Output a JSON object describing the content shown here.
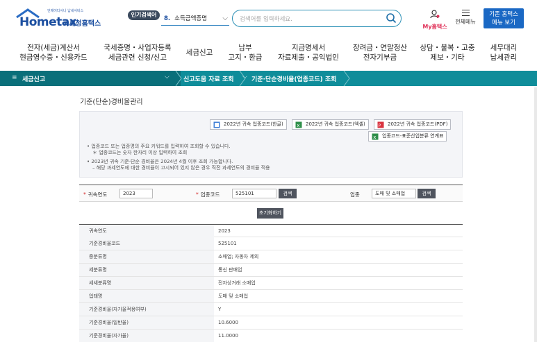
{
  "header": {
    "logo_slogan": "언제어디서나 납세서비스",
    "logo_brand": "Hometax",
    "logo_brand_kr": "국세청홈택스",
    "popular_badge": "인기검색어",
    "popular_rank": "8.",
    "popular_term": "소득금액증명",
    "search_placeholder": "검색어를 입력하세요.",
    "my_hometax": "My홈택스",
    "all_menu": "전체메뉴",
    "basic_btn_line1": "기존 홈택스",
    "basic_btn_line2": "메뉴 보기"
  },
  "gnb": [
    {
      "line1": "전자(세금)계산서",
      "line2": "현금영수증・신용카드"
    },
    {
      "line1": "국세증명・사업자등록",
      "line2": "세금관련 신청/신고"
    },
    {
      "line1": "세금신고",
      "line2": ""
    },
    {
      "line1": "납부",
      "line2": "고지・환급"
    },
    {
      "line1": "지급명세서",
      "line2": "자료제출・공익법인"
    },
    {
      "line1": "장려금・연말정산",
      "line2": "전자기부금"
    },
    {
      "line1": "상담・불복・고충",
      "line2": "제보・기타"
    },
    {
      "line1": "세무대리",
      "line2": "납세관리"
    }
  ],
  "location": {
    "root": "세금신고",
    "crumb1": "신고도움 자료 조회",
    "crumb2": "기준·단순경비율(업종코드) 조회"
  },
  "page_title": "기준(단순)경비율관리",
  "downloads": {
    "excel_hangul": "2022년 귀속 업종코드(한글)",
    "excel": "2022년 귀속 업종코드(엑셀)",
    "pdf": "2022년 귀속 업종코드(PDF)",
    "link": "업종코드-표준산업분류 연계표"
  },
  "notices": [
    "업종코드 또는 업종명의 주요 키워드를 입력하여 조회할 수 있습니다.",
    "＊ 업종코드는 숫자 한자리 이상 입력하여 조회",
    "2023년 귀속 기준·단순 경비율은 2024년 4월 이후 조회 가능합니다.",
    "– 해당 과세연도에 대한 경비율이 고시되어 있지 않은 경우 직전 과세연도의 경비율 적용"
  ],
  "form": {
    "year_label": "귀속연도",
    "year_value": "2023",
    "code_label": "업종코드",
    "code_value": "525101",
    "search_btn": "검색",
    "type_label": "업종",
    "type_value": "도매 및 소매업",
    "search_btn2": "검색",
    "reset_btn": "초기화하기"
  },
  "results": [
    {
      "key": "귀속연도",
      "value": "2023"
    },
    {
      "key": "기준경비율코드",
      "value": "525101"
    },
    {
      "key": "중분류명",
      "value": "소매업; 자동차 제외"
    },
    {
      "key": "세분류명",
      "value": "통신 판매업"
    },
    {
      "key": "세세분류명",
      "value": "전자상거래 소매업"
    },
    {
      "key": "업태명",
      "value": "도매 및 소매업"
    },
    {
      "key": "기준경비율(자가율적용여부)",
      "value": "Y"
    },
    {
      "key": "기준경비율(일반율)",
      "value": "10.6000"
    },
    {
      "key": "기준경비율(자가율)",
      "value": "11.0000"
    }
  ],
  "colors": {
    "brand_blue": "#1c4fa0",
    "teal_bar": "#0f8d9a",
    "teal_dark": "#0a6f7a",
    "accent_pink": "#e0335a",
    "required_red": "#d62b2b"
  }
}
